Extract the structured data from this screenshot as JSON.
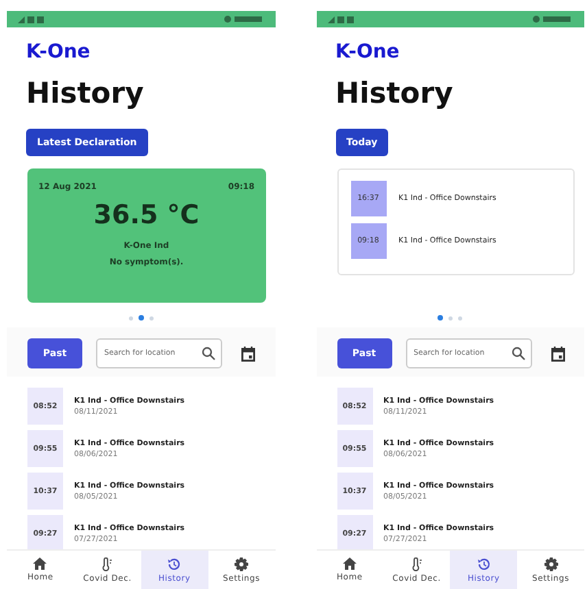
{
  "screens": [
    {
      "logo": "K-One",
      "title": "History",
      "header_button": "Latest Declaration",
      "card": {
        "kind": "declaration",
        "date": "12 Aug 2021",
        "time": "09:18",
        "temperature": "36.5 °C",
        "location": "K-One Ind",
        "symptoms": "No symptom(s)."
      },
      "pager": [
        {
          "selected": false
        },
        {
          "selected": true
        },
        {
          "selected": false
        }
      ],
      "filter_button": "Past",
      "search": {
        "placeholder": "Search for location"
      },
      "entries": [
        {
          "time": "08:52",
          "location": "K1 Ind - Office Downstairs",
          "date": "08/11/2021"
        },
        {
          "time": "09:55",
          "location": "K1 Ind - Office Downstairs",
          "date": "08/06/2021"
        },
        {
          "time": "10:37",
          "location": "K1 Ind - Office Downstairs",
          "date": "08/05/2021"
        },
        {
          "time": "09:27",
          "location": "K1 Ind - Office Downstairs",
          "date": "07/27/2021"
        }
      ],
      "nav": [
        {
          "label": "Home",
          "kind": "home",
          "selected": false
        },
        {
          "label": "Covid Dec.",
          "kind": "thermometer",
          "selected": false
        },
        {
          "label": "History",
          "kind": "history",
          "selected": true
        },
        {
          "label": "Settings",
          "kind": "gear",
          "selected": false
        }
      ]
    },
    {
      "logo": "K-One",
      "title": "History",
      "header_button": "Today",
      "card": {
        "kind": "list",
        "entries": [
          {
            "time": "16:37",
            "location": "K1 Ind - Office Downstairs"
          },
          {
            "time": "09:18",
            "location": "K1 Ind - Office Downstairs"
          }
        ]
      },
      "pager": [
        {
          "selected": true
        },
        {
          "selected": false
        },
        {
          "selected": false
        }
      ],
      "filter_button": "Past",
      "search": {
        "placeholder": "Search for location"
      },
      "entries": [
        {
          "time": "08:52",
          "location": "K1 Ind - Office Downstairs",
          "date": "08/11/2021"
        },
        {
          "time": "09:55",
          "location": "K1 Ind - Office Downstairs",
          "date": "08/06/2021"
        },
        {
          "time": "10:37",
          "location": "K1 Ind - Office Downstairs",
          "date": "08/05/2021"
        },
        {
          "time": "09:27",
          "location": "K1 Ind - Office Downstairs",
          "date": "07/27/2021"
        }
      ],
      "nav": [
        {
          "label": "Home",
          "kind": "home",
          "selected": false
        },
        {
          "label": "Covid Dec.",
          "kind": "thermometer",
          "selected": false
        },
        {
          "label": "History",
          "kind": "history",
          "selected": true
        },
        {
          "label": "Settings",
          "kind": "gear",
          "selected": false
        }
      ]
    }
  ]
}
